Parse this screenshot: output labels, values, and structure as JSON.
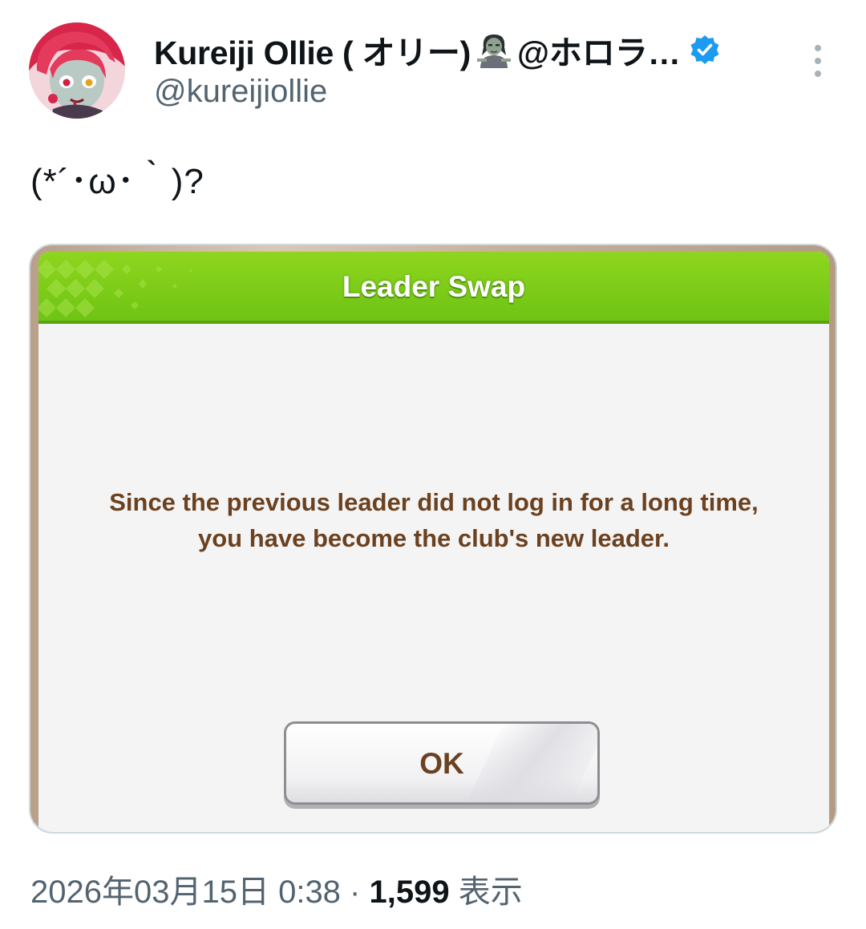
{
  "author": {
    "display_name": "Kureiji Ollie ( オリー)",
    "name_suffix": "@ホロラ…",
    "handle": "@kureijiollie",
    "verified": true,
    "avatar_icon": "anime-avatar-icon",
    "name_emoji_icon": "zombie-woman-icon"
  },
  "tweet": {
    "text": "(*´･ω･｀)?"
  },
  "media": {
    "dialog_title": "Leader Swap",
    "message_line1": "Since the previous leader did not log in for a long time,",
    "message_line2": "you have become the club's new leader.",
    "ok_label": "OK",
    "colors": {
      "header_green": "#7cc91a",
      "text_brown": "#6b4120",
      "dialog_bg": "#f4f4f4"
    }
  },
  "meta": {
    "date": "2026年03月15日 0:38",
    "separator": " · ",
    "views_count": "1,599",
    "views_label": " 表示"
  },
  "colors": {
    "primary_text": "#0f1419",
    "secondary_text": "#536471",
    "verified_blue": "#1d9bf0"
  }
}
